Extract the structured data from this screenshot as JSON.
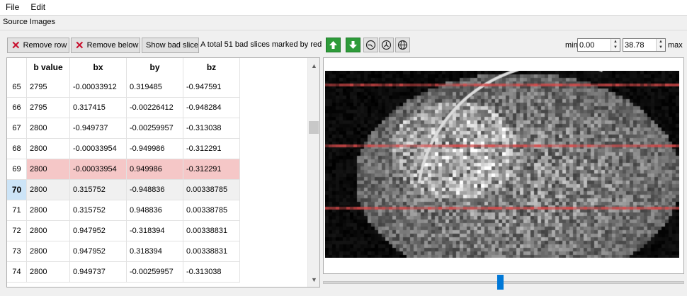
{
  "menu": {
    "file": "File",
    "edit": "Edit"
  },
  "group_title": "Source Images",
  "toolbar": {
    "remove_row": "Remove row",
    "remove_below": "Remove below",
    "show_bad_slice": "Show bad slice",
    "status": "A total 51 bad slices marked by red"
  },
  "icons": [
    "up-arrow-icon",
    "down-arrow-icon",
    "clock-icon",
    "clock-alt-icon",
    "sphere-icon"
  ],
  "contrast": {
    "min_label": "min",
    "min_value": "0.00",
    "max_value": "38.78",
    "max_label": "max"
  },
  "table": {
    "headers": [
      "b value",
      "bx",
      "by",
      "bz"
    ],
    "rows": [
      {
        "id": "65",
        "b": "2795",
        "bx": "-0.00033912",
        "by": "0.319485",
        "bz": "-0.947591"
      },
      {
        "id": "66",
        "b": "2795",
        "bx": "0.317415",
        "by": "-0.00226412",
        "bz": "-0.948284"
      },
      {
        "id": "67",
        "b": "2800",
        "bx": "-0.949737",
        "by": "-0.00259957",
        "bz": "-0.313038"
      },
      {
        "id": "68",
        "b": "2800",
        "bx": "-0.00033954",
        "by": "-0.949986",
        "bz": "-0.312291"
      },
      {
        "id": "69",
        "b": "2800",
        "bx": "-0.00033954",
        "by": "0.949986",
        "bz": "-0.312291"
      },
      {
        "id": "70",
        "b": "2800",
        "bx": "0.315752",
        "by": "-0.948836",
        "bz": "0.00338785"
      },
      {
        "id": "71",
        "b": "2800",
        "bx": "0.315752",
        "by": "0.948836",
        "bz": "0.00338785"
      },
      {
        "id": "72",
        "b": "2800",
        "bx": "0.947952",
        "by": "-0.318394",
        "bz": "0.00338831"
      },
      {
        "id": "73",
        "b": "2800",
        "bx": "0.947952",
        "by": "0.318394",
        "bz": "0.00338831"
      },
      {
        "id": "74",
        "b": "2800",
        "bx": "0.949737",
        "by": "-0.00259957",
        "bz": "-0.313038"
      }
    ],
    "bad_row": "69",
    "current_row": "70"
  },
  "colors": {
    "bad_row": "#f5c7c7",
    "selection": "#cce4f7",
    "accent": "#0078d7",
    "green_button": "#2e9b3a",
    "bad_slice_line": "#d84a4a"
  },
  "slider": {
    "position_fraction": 0.49
  }
}
